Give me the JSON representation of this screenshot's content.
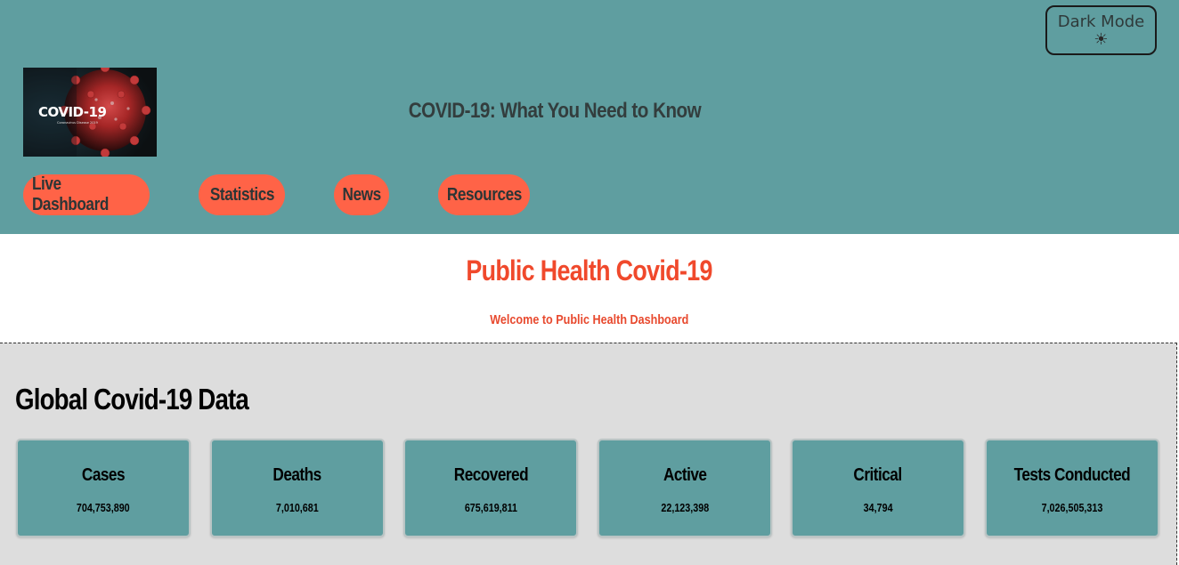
{
  "header": {
    "dark_mode_label": "Dark Mode",
    "dark_mode_icon": "sun-gear-icon",
    "site_title": "COVID-19: What You Need to Know",
    "logo": {
      "text": "COVID-19",
      "subtext": "Coronavirus Disease 2019"
    }
  },
  "nav": {
    "items": [
      {
        "label": "Live Dashboard"
      },
      {
        "label": "Statistics"
      },
      {
        "label": "News"
      },
      {
        "label": "Resources"
      }
    ]
  },
  "hero": {
    "title": "Public Health Covid-19",
    "subtitle": "Welcome to Public Health Dashboard"
  },
  "global_data": {
    "title": "Global Covid-19 Data",
    "stats": [
      {
        "label": "Cases",
        "value": "704,753,890"
      },
      {
        "label": "Deaths",
        "value": "7,010,681"
      },
      {
        "label": "Recovered",
        "value": "675,619,811"
      },
      {
        "label": "Active",
        "value": "22,123,398"
      },
      {
        "label": "Critical",
        "value": "34,794"
      },
      {
        "label": "Tests Conducted",
        "value": "7,026,505,313"
      }
    ]
  },
  "colors": {
    "header_bg": "#5f9ea0",
    "nav_button_bg": "#ff6347",
    "hero_text": "#f0492c",
    "section_bg": "#dddddd",
    "card_bg": "#5f9ea0"
  }
}
